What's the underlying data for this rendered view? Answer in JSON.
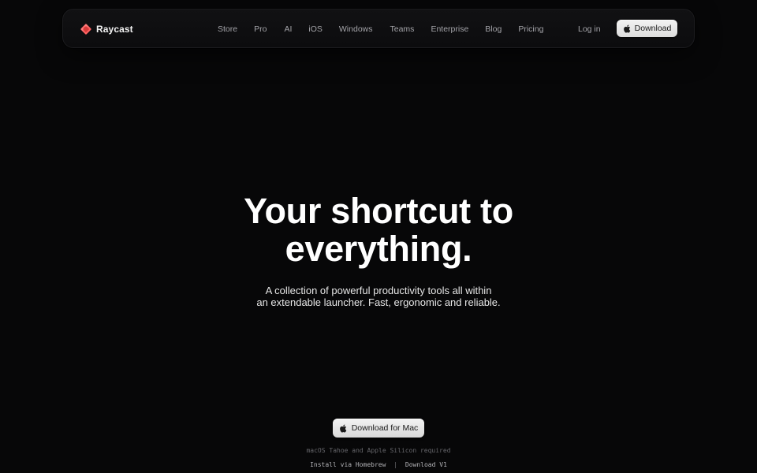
{
  "header": {
    "brand": "Raycast",
    "nav": [
      "Store",
      "Pro",
      "AI",
      "iOS",
      "Windows",
      "Teams",
      "Enterprise",
      "Blog",
      "Pricing"
    ],
    "login_label": "Log in",
    "download_label": "Download"
  },
  "hero": {
    "title_line1": "Your shortcut to",
    "title_line2": "everything.",
    "subtitle_line1": "A collection of powerful productivity tools all within",
    "subtitle_line2": "an extendable launcher. Fast, ergonomic and reliable."
  },
  "cta": {
    "download_mac_label": "Download for Mac",
    "requirements": "macOS Tahoe and Apple Silicon required",
    "homebrew_label": "Install via Homebrew",
    "separator": "|",
    "v1_label": "Download V1"
  },
  "icons": {
    "logo": "raycast-logo-icon",
    "apple": "apple-icon"
  },
  "colors": {
    "background": "#070708",
    "brand_accent": "#ff6363",
    "button_bg": "#e8e8e8",
    "nav_text": "#a3a3a8"
  }
}
